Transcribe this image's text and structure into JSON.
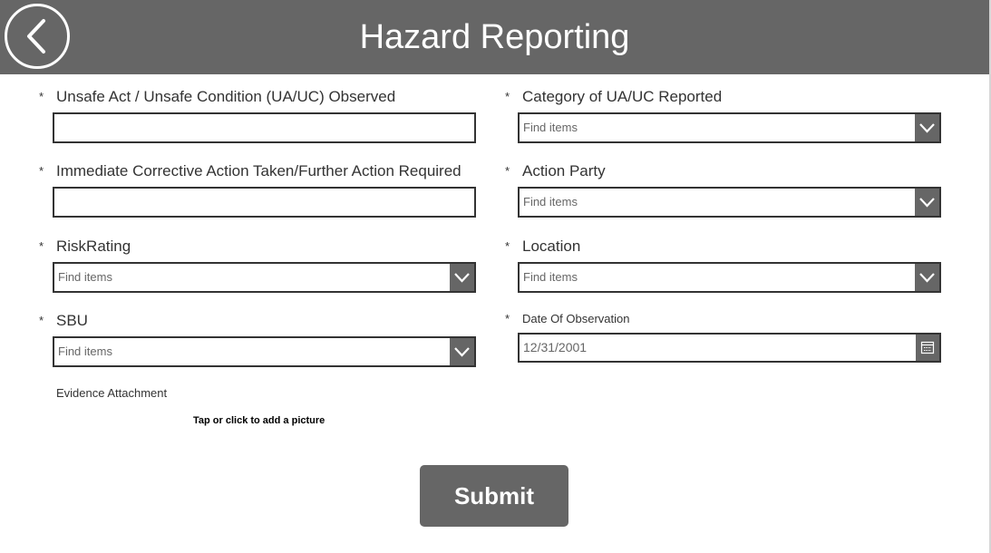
{
  "header": {
    "title": "Hazard Reporting",
    "back_icon": "chevron-left-icon"
  },
  "form": {
    "required_marker": "*",
    "unsafe_act": {
      "label": "Unsafe Act / Unsafe Condition (UA/UC) Observed",
      "value": ""
    },
    "corrective_action": {
      "label": "Immediate Corrective Action Taken/Further Action Required",
      "value": ""
    },
    "risk_rating": {
      "label": "RiskRating",
      "placeholder": "Find items"
    },
    "sbu": {
      "label": "SBU",
      "placeholder": "Find items"
    },
    "category": {
      "label": "Category of UA/UC Reported",
      "placeholder": "Find items"
    },
    "action_party": {
      "label": "Action Party",
      "placeholder": "Find items"
    },
    "location": {
      "label": "Location",
      "placeholder": "Find items"
    },
    "date_of_observation": {
      "label": "Date Of Observation",
      "value": "12/31/2001",
      "icon": "calendar-icon"
    },
    "evidence": {
      "label": "Evidence Attachment",
      "add_picture_text": "Tap or click to add a picture"
    },
    "submit_label": "Submit"
  },
  "colors": {
    "header_bg": "#666666",
    "accent_gray": "#666666",
    "border": "#333333",
    "text": "#333333"
  }
}
